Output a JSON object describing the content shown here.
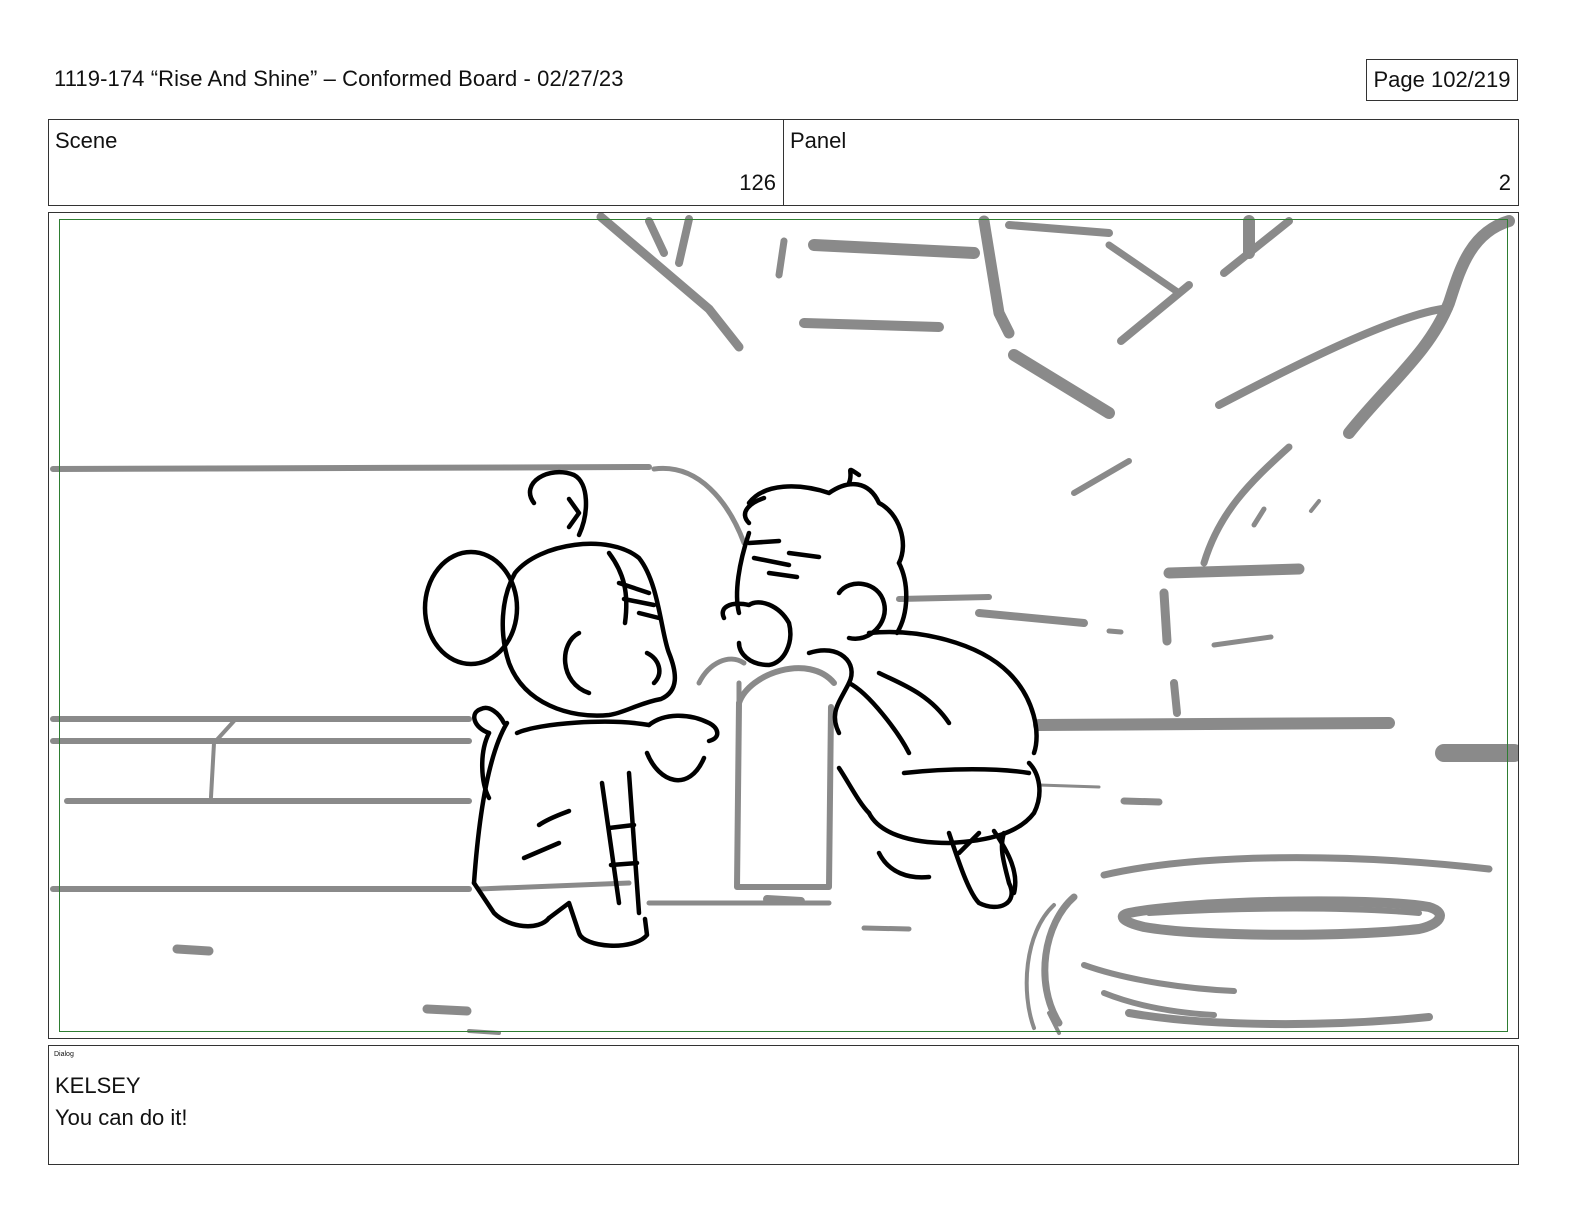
{
  "header": {
    "title": "1119-174 “Rise And Shine” – Conformed Board - 02/27/23",
    "page_label": "Page 102/219"
  },
  "info": {
    "scene_label": "Scene",
    "scene_value": "126",
    "panel_label": "Panel",
    "panel_value": "2"
  },
  "panel_image": {
    "description_icon": "storyboard-sketch",
    "safe_area_color": "#2e7d32",
    "background_line_color": "#8a8a8a",
    "character_line_color": "#000000"
  },
  "dialog": {
    "label": "Dialog",
    "speaker": "KELSEY",
    "line": "You can do it!"
  }
}
